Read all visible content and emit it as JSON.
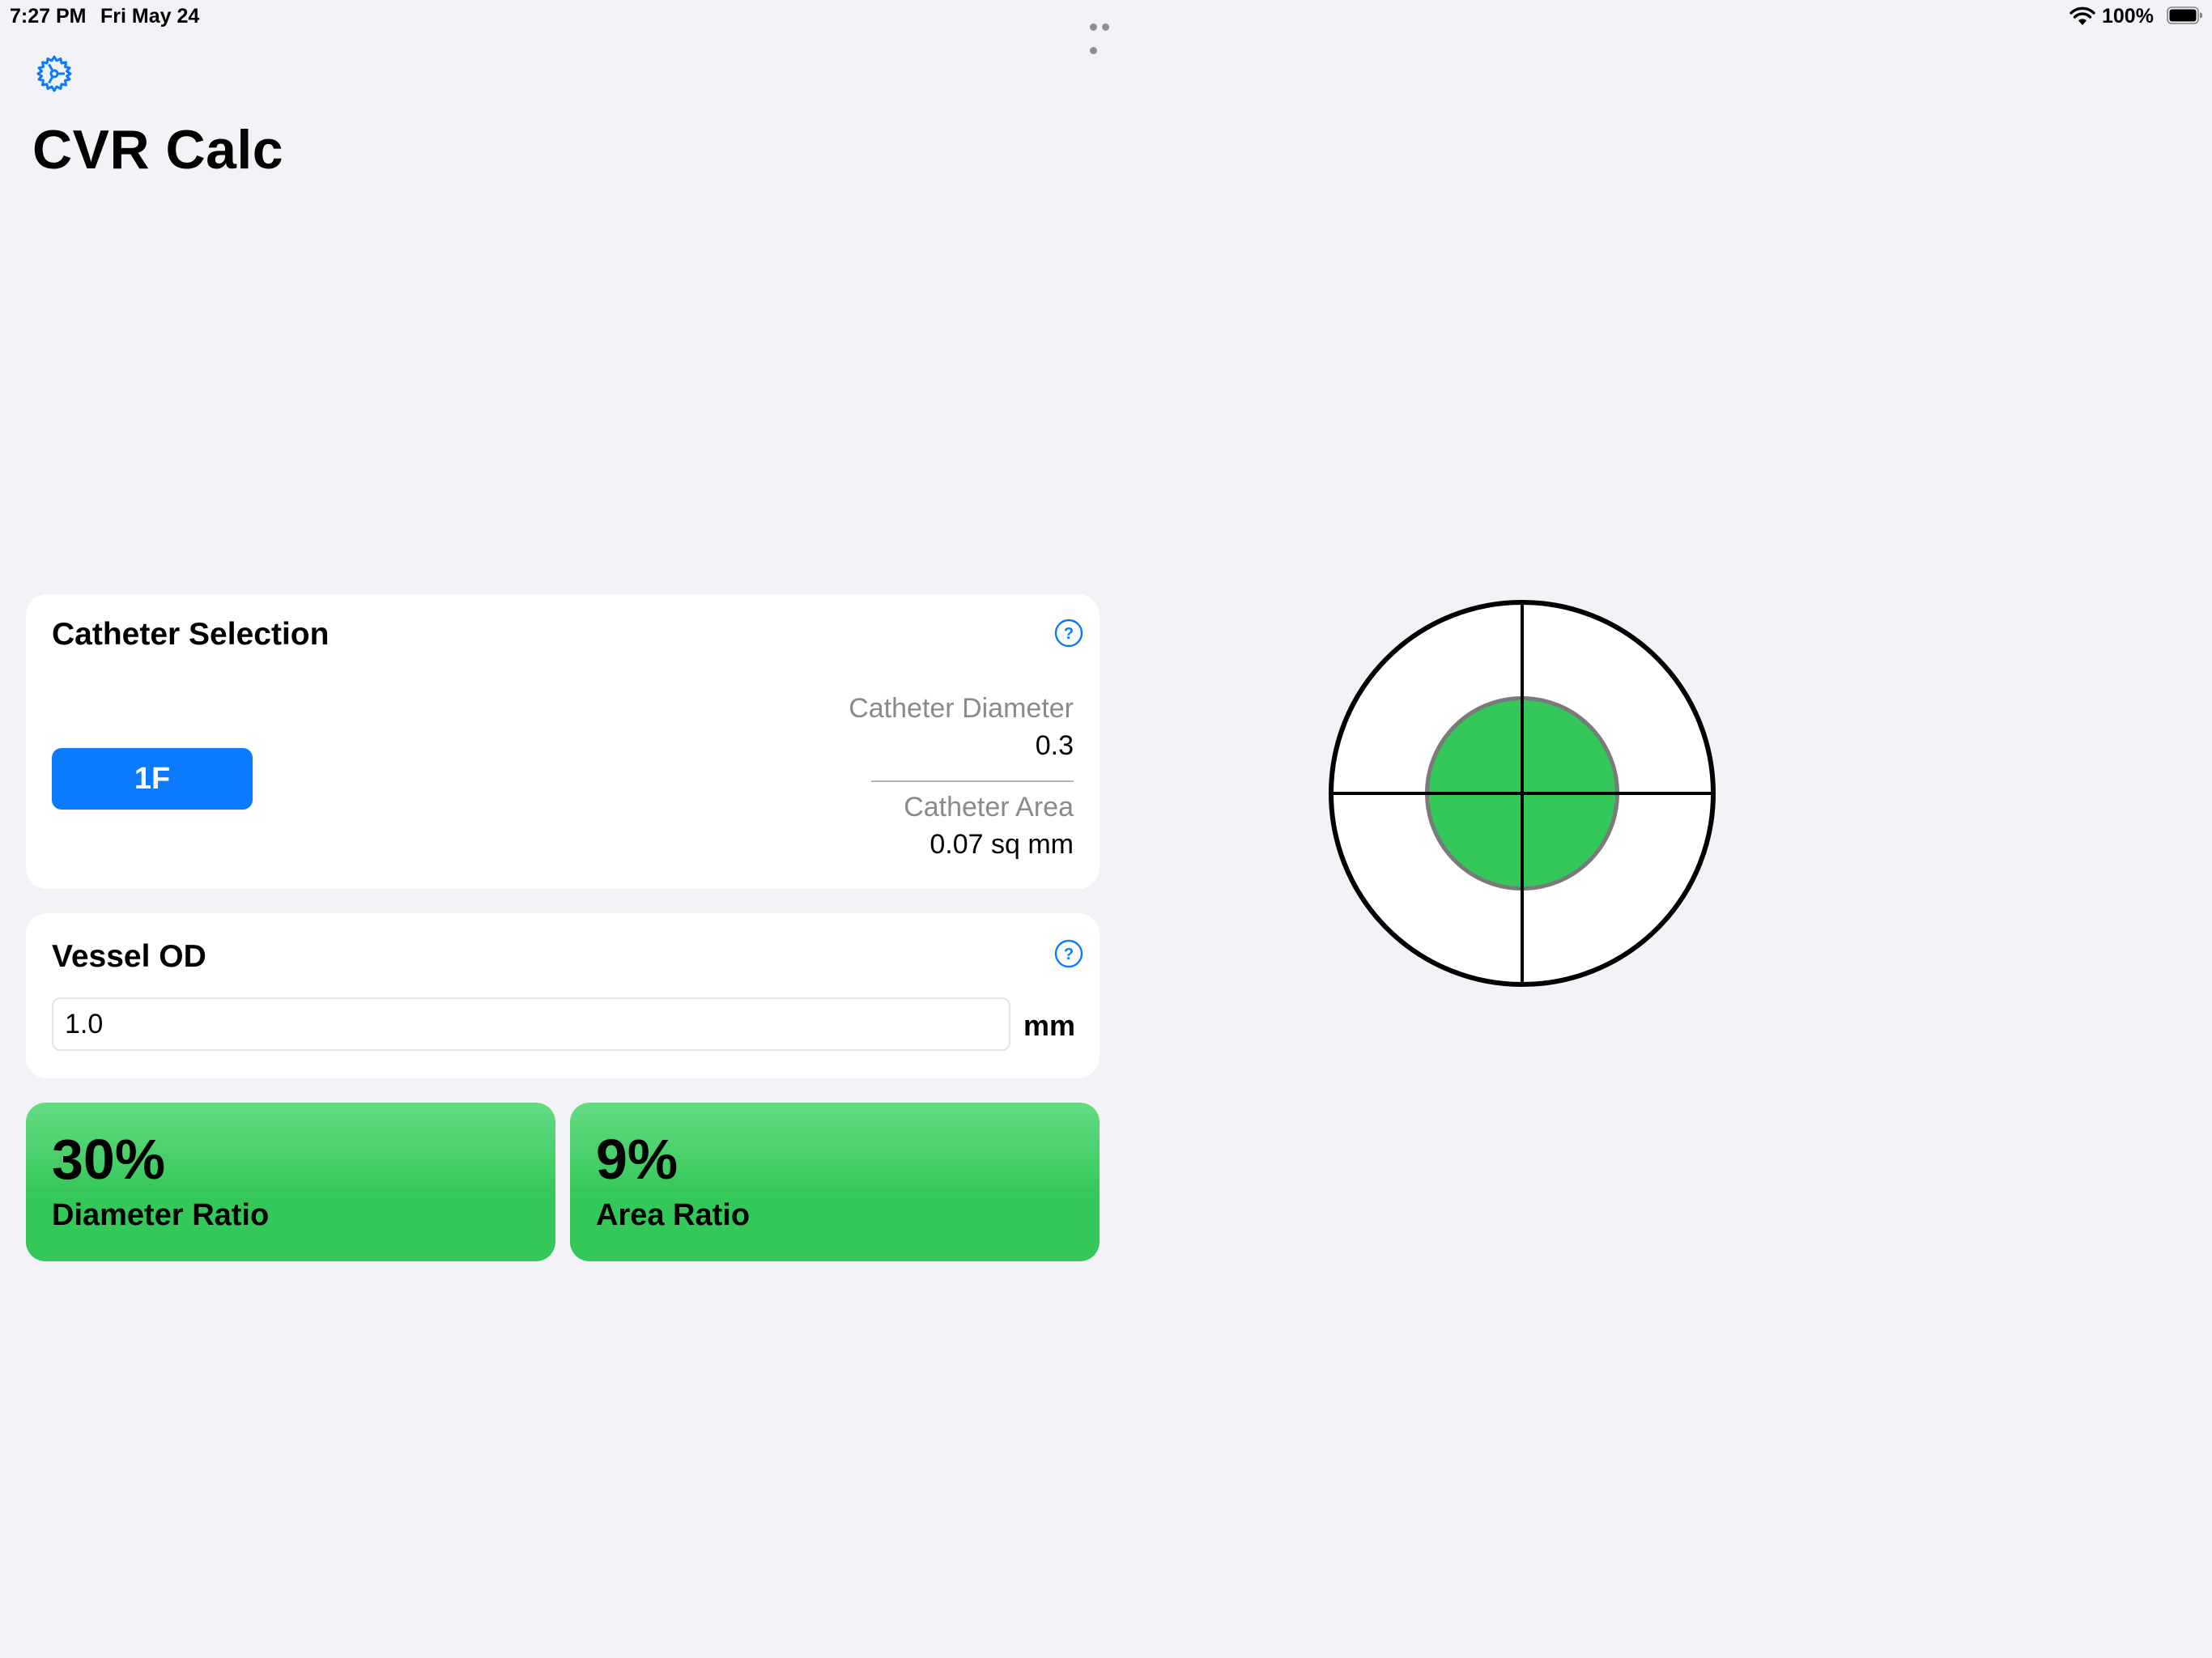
{
  "status_bar": {
    "time": "7:27 PM",
    "date": "Fri May 24",
    "battery_percent": "100%",
    "icons": [
      "multitasking-dots-icon",
      "wifi-icon",
      "battery-icon"
    ]
  },
  "header": {
    "settings_icon": "gear-icon",
    "title": "CVR Calc"
  },
  "catheter_selection": {
    "title": "Catheter Selection",
    "help_icon": "question-circle-icon",
    "french_size_button": "1F",
    "diameter_label": "Catheter Diameter",
    "diameter_value": "0.3",
    "area_label": "Catheter Area",
    "area_value": "0.07 sq mm"
  },
  "vessel_od": {
    "title": "Vessel OD",
    "help_icon": "question-circle-icon",
    "input_value": "1.0",
    "unit": "mm"
  },
  "results": {
    "diameter_ratio_value": "30%",
    "diameter_ratio_label": "Diameter Ratio",
    "area_ratio_value": "9%",
    "area_ratio_label": "Area Ratio"
  },
  "diagram": {
    "vessel_fill": "#FFFFFF",
    "catheter_fill": "#34C759",
    "catheter_to_vessel_diameter_ratio": 0.3
  },
  "colors": {
    "accent": "#0A7AFF",
    "result_green": "#34C759",
    "background": "#F2F2F7"
  }
}
